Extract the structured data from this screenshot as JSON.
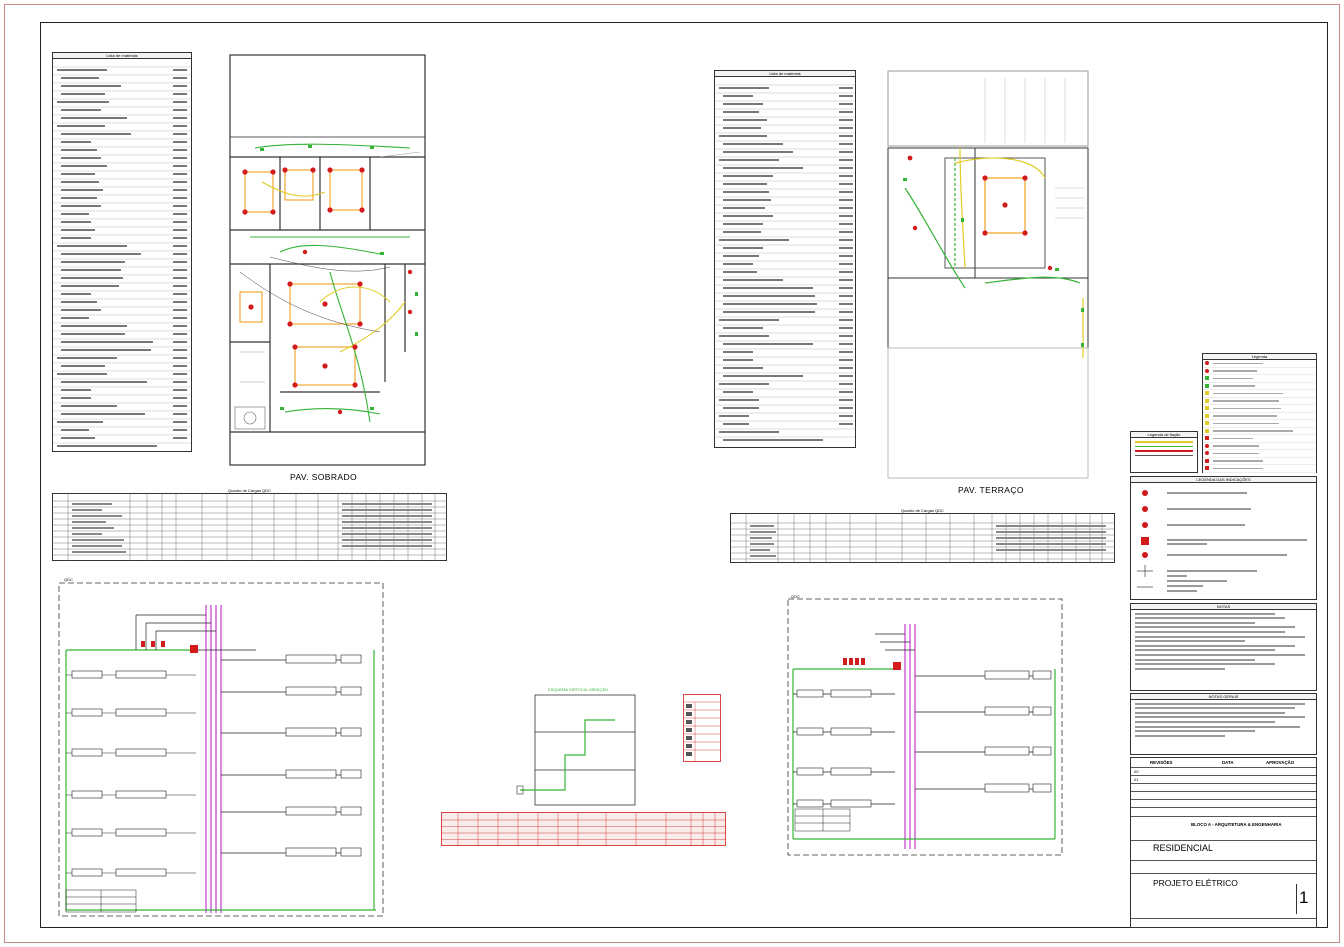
{
  "plans": {
    "sobrado_label": "PAV. SOBRADO",
    "terraco_label": "PAV. TERRAÇO"
  },
  "materials_list": {
    "title_left": "Lista de materiais",
    "title_right": "Lista de materiais"
  },
  "load_tables": {
    "left_title": "Quadro de Cargas QDC",
    "right_title": "Quadro de Cargas QDC"
  },
  "unifilar": {
    "left_tag": "QDC",
    "right_tag": "QDC",
    "center_title": "ESQUEMA VERTICAL MEDIÇÃO"
  },
  "legend": {
    "title": "Legenda",
    "fiação_title": "Legenda de fiação",
    "conventions_title": "LEGENDA DAS INDICAÇÕES",
    "notes_title": "NOTAS",
    "general_notes_title": "NOTAS GERAIS"
  },
  "titleblock": {
    "revisions_header": "REVISÕES",
    "date_header": "DATA",
    "approval_header": "APROVAÇÃO",
    "rev_0": "00",
    "rev_1": "01",
    "company": "BLOCO A - ARQUITETURA & ENGENHARIA",
    "project_type": "RESIDENCIAL",
    "drawing_title": "PROJETO ELÉTRICO",
    "sheet_number": "1"
  },
  "colors": {
    "red_circuit": "#d21c1c",
    "green_circuit": "#35b335",
    "magenta_circuit": "#c43ad0",
    "orange_wall": "#f0a020",
    "yellow_circuit": "#e0cc22",
    "frame_pink": "#c98b8b"
  }
}
